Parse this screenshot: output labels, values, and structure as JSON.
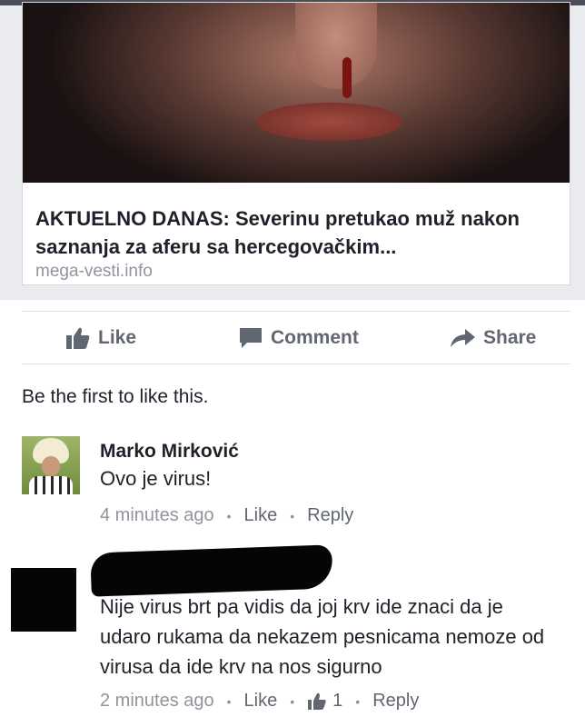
{
  "link_preview": {
    "title": "AKTUELNO DANAS: Severinu pretukao muž nakon saznanja za aferu sa hercegovačkim...",
    "domain": "mega-vesti.info"
  },
  "actions": {
    "like": "Like",
    "comment": "Comment",
    "share": "Share"
  },
  "likes_summary": "Be the first to like this.",
  "comments": [
    {
      "author": "Marko Mirković",
      "text": "Ovo je virus!",
      "time": "4 minutes ago",
      "like": "Like",
      "reply": "Reply"
    },
    {
      "author": "",
      "text": "Nije virus brt pa vidis da joj krv ide znaci da je udaro rukama da nekazem pesnicama nemoze od virusa da ide krv na nos sigurno",
      "time": "2 minutes ago",
      "like": "Like",
      "reaction_count": "1",
      "reply": "Reply"
    }
  ],
  "colors": {
    "text": "#1d2129",
    "muted": "#90949c",
    "action": "#616770",
    "background": "#e9ebee"
  },
  "icons": {
    "like": "thumbs-up-icon",
    "comment": "speech-bubble-icon",
    "share": "share-arrow-icon"
  }
}
